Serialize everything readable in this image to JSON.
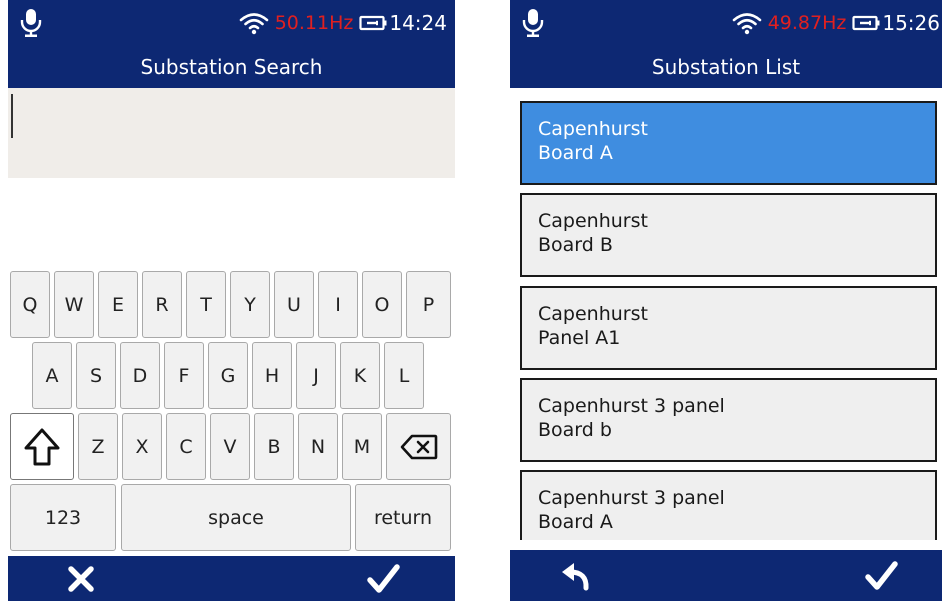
{
  "left_screen": {
    "status": {
      "frequency": "50.11Hz",
      "time": "14:24"
    },
    "title": "Substation Search",
    "search": {
      "value": ""
    },
    "keyboard": {
      "row1": [
        "Q",
        "W",
        "E",
        "R",
        "T",
        "Y",
        "U",
        "I",
        "O",
        "P"
      ],
      "row2": [
        "A",
        "S",
        "D",
        "F",
        "G",
        "H",
        "J",
        "K",
        "L"
      ],
      "row3": [
        "Z",
        "X",
        "C",
        "V",
        "B",
        "N",
        "M"
      ],
      "numbers_label": "123",
      "space_label": "space",
      "return_label": "return"
    },
    "icons": {
      "cancel": "cross-icon",
      "confirm": "checkmark-icon",
      "shift": "shift-arrow-icon",
      "backspace": "backspace-icon"
    }
  },
  "right_screen": {
    "status": {
      "frequency": "49.87Hz",
      "time": "15:26"
    },
    "title": "Substation List",
    "items": [
      {
        "line1": "Capenhurst",
        "line2": "Board A",
        "selected": true
      },
      {
        "line1": "Capenhurst",
        "line2": "Board B",
        "selected": false
      },
      {
        "line1": "Capenhurst",
        "line2": "Panel A1",
        "selected": false
      },
      {
        "line1": "Capenhurst 3 panel",
        "line2": "Board b",
        "selected": false
      },
      {
        "line1": "Capenhurst 3 panel",
        "line2": "Board A",
        "selected": false
      }
    ],
    "icons": {
      "back": "back-arrow-icon",
      "confirm": "checkmark-icon"
    }
  },
  "colors": {
    "bar_background": "#0d2873",
    "frequency_text": "#e02020",
    "selected_item": "#3f8de0",
    "search_field": "#f0ede9",
    "key_background": "#f1f1f1"
  }
}
